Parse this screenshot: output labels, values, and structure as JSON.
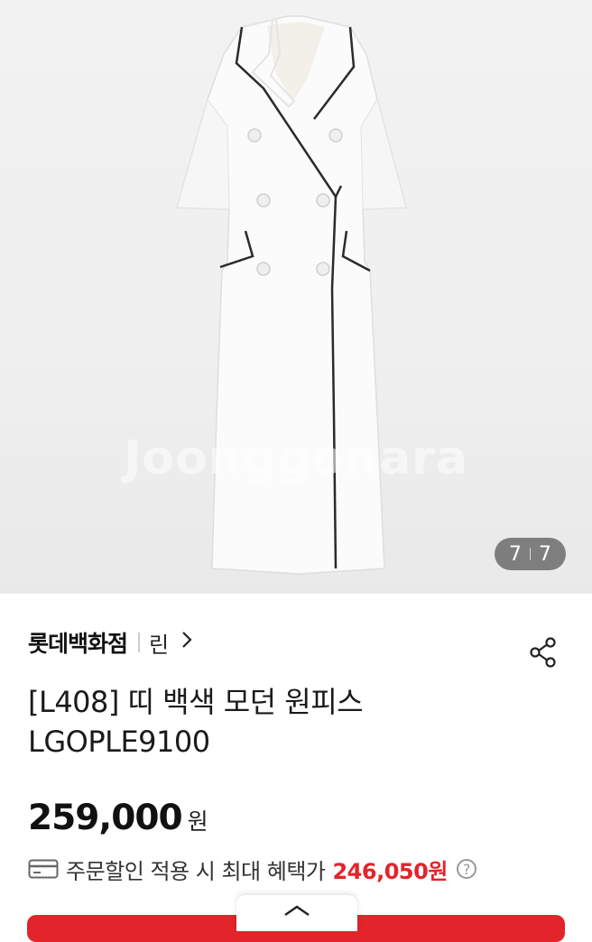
{
  "gallery": {
    "image_alt": "white double-breasted dress",
    "watermark": "Joonggonara",
    "counter_current": "7",
    "counter_total": "7"
  },
  "product": {
    "brand": "롯데백화점",
    "sub_brand": "린",
    "title_line1": "[L408] 띠 백색 모던 원피스",
    "title_line2": "LGOPLE9100",
    "price": "259,000",
    "price_unit": "원",
    "benefit_text": "주문할인 적용 시 최대 혜택가",
    "benefit_price": "246,050원",
    "help_glyph": "?"
  },
  "icons": [
    "chevron-right-icon",
    "share-icon",
    "card-icon",
    "help-icon",
    "chevron-up-icon"
  ],
  "colors": {
    "accent": "#e3242b",
    "text": "#111111",
    "muted": "#999999"
  }
}
